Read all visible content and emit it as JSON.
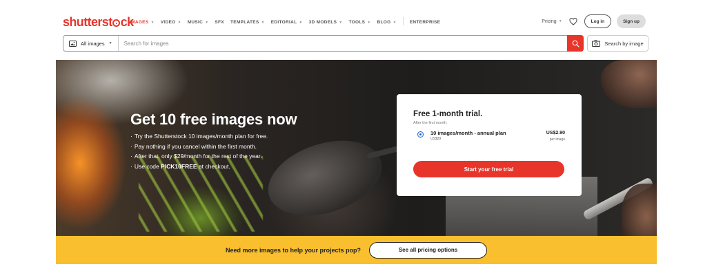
{
  "logo": {
    "pre": "shutterst",
    "post": "ck"
  },
  "nav": {
    "items": [
      {
        "label": "IMAGES",
        "active": true,
        "caret": true
      },
      {
        "label": "VIDEO",
        "caret": true
      },
      {
        "label": "MUSIC",
        "caret": true
      },
      {
        "label": "SFX",
        "caret": false
      },
      {
        "label": "TEMPLATES",
        "caret": true
      },
      {
        "label": "EDITORIAL",
        "caret": true
      },
      {
        "label": "3D MODELS",
        "caret": true
      },
      {
        "label": "TOOLS",
        "caret": true
      },
      {
        "label": "BLOG",
        "caret": true
      },
      {
        "label": "ENTERPRISE",
        "caret": false
      }
    ],
    "pricing": "Pricing",
    "login": "Log in",
    "signup": "Sign up"
  },
  "search": {
    "filter": "All images",
    "placeholder": "Search for images",
    "by_image": "Search by image"
  },
  "hero": {
    "title": "Get 10 free images now",
    "bullets": [
      "Try the Shutterstock 10 images/month plan for free.",
      "Pay nothing if you cancel within the first month.",
      "After that, only $29/month for the rest of the year."
    ],
    "code_pre": "Use code ",
    "code": "PICK10FREE",
    "code_post": " at checkout."
  },
  "trial": {
    "title": "Free 1-month trial.",
    "subtitle": "After the first month:",
    "plan_name": "10 images/month - annual plan",
    "plan_sub": "US$29",
    "price": "US$2.90",
    "unit": "per image",
    "cta": "Start your free trial"
  },
  "promo": {
    "text": "Need more images to help your projects pop?",
    "button": "See all pricing options"
  },
  "colors": {
    "brand": "#e8352a",
    "promo_bg": "#f9bf2f",
    "radio": "#1a5fd4"
  }
}
